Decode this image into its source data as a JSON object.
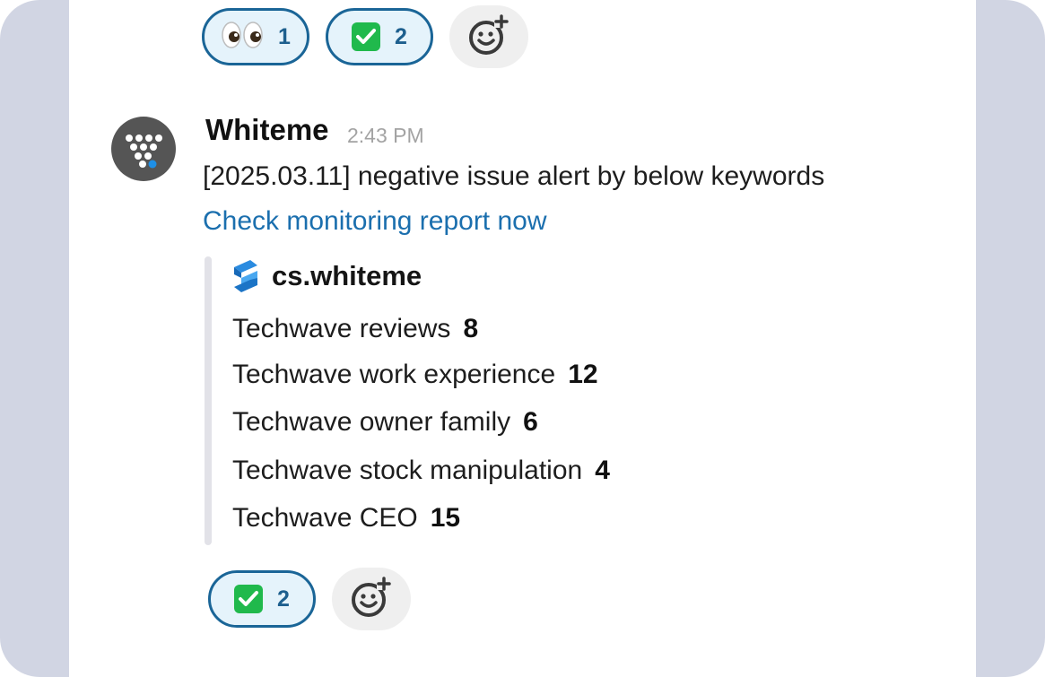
{
  "top_reactions": [
    {
      "emoji": "eyes",
      "count": "1"
    },
    {
      "emoji": "check",
      "count": "2"
    }
  ],
  "message": {
    "author": "Whiteme",
    "time": "2:43 PM",
    "text": "[2025.03.11] negative issue alert by below keywords",
    "link": "Check monitoring report now",
    "attachment": {
      "source": "cs.whiteme",
      "keywords": [
        {
          "label": "Techwave reviews",
          "count": "8"
        },
        {
          "label": "Techwave work experience",
          "count": "12"
        },
        {
          "label": "Techwave owner family",
          "count": "6"
        },
        {
          "label": "Techwave stock manipulation",
          "count": "4"
        },
        {
          "label": "Techwave CEO",
          "count": "15"
        }
      ]
    }
  },
  "bottom_reactions": [
    {
      "emoji": "check",
      "count": "2"
    }
  ],
  "colors": {
    "accent": "#1a6597",
    "link": "#1b6fae",
    "pill_bg": "#e5f3fb",
    "frame": "#d1d5e3"
  },
  "icons": [
    "eyes-emoji-icon",
    "check-emoji-icon",
    "add-reaction-icon",
    "whiteme-logo-icon",
    "source-logo-icon"
  ]
}
